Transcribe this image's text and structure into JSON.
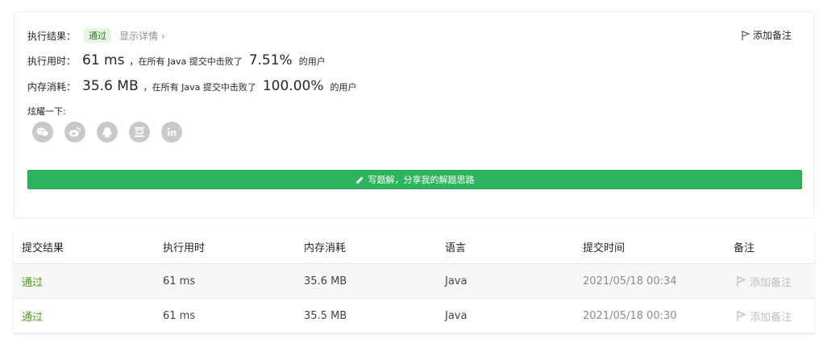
{
  "result": {
    "label": "执行结果：",
    "status": "通过",
    "detail_link": "显示详情 ›",
    "add_note": "添加备注"
  },
  "runtime": {
    "label": "执行用时：",
    "value": "61 ms",
    "middle": "，在所有 Java 提交中击败了",
    "percent": "7.51%",
    "suffix": "的用户"
  },
  "memory": {
    "label": "内存消耗：",
    "value": "35.6 MB",
    "middle": "，在所有 Java 提交中击败了",
    "percent": "100.00%",
    "suffix": "的用户"
  },
  "share": {
    "label": "炫耀一下:",
    "icons": [
      "wechat-icon",
      "weibo-icon",
      "qq-icon",
      "douban-icon",
      "linkedin-icon"
    ]
  },
  "write_solution": {
    "label": "写题解，分享我的解题思路"
  },
  "submissions": {
    "headers": [
      "提交结果",
      "执行用时",
      "内存消耗",
      "语言",
      "提交时间",
      "备注"
    ],
    "rows": [
      {
        "status": "通过",
        "runtime": "61 ms",
        "memory": "35.6 MB",
        "language": "Java",
        "time": "2021/05/18 00:34",
        "note": "添加备注"
      },
      {
        "status": "通过",
        "runtime": "61 ms",
        "memory": "35.5 MB",
        "language": "Java",
        "time": "2021/05/18 00:30",
        "note": "添加备注"
      }
    ]
  },
  "colors": {
    "accent_green": "#2db55d",
    "status_green": "#4ea11c",
    "icon_gray": "#c9c9c9"
  }
}
